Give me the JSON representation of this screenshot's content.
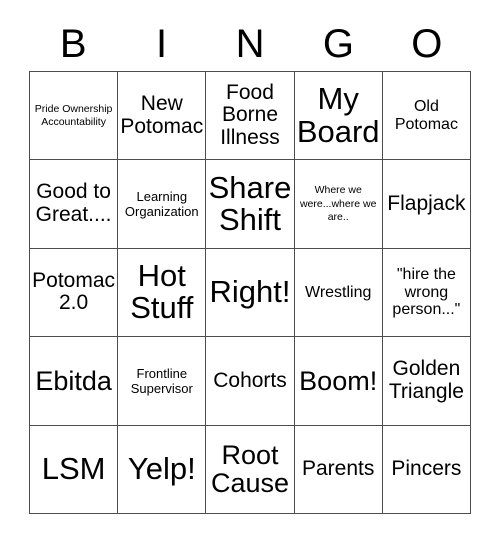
{
  "header": {
    "letters": [
      "B",
      "I",
      "N",
      "G",
      "O"
    ]
  },
  "grid": {
    "columns": 5,
    "rows": 5,
    "cells": [
      {
        "text": "Pride Ownership Accountability",
        "size": "xxs"
      },
      {
        "text": "New Potomac",
        "size": "md"
      },
      {
        "text": "Food Borne Illness",
        "size": "md"
      },
      {
        "text": "My Board",
        "size": "xl"
      },
      {
        "text": "Old Potomac",
        "size": "sm"
      },
      {
        "text": "Good to Great....",
        "size": "md"
      },
      {
        "text": "Learning Organization",
        "size": "xs"
      },
      {
        "text": "Share Shift",
        "size": "xl"
      },
      {
        "text": "Where we were...where we are..",
        "size": "xxs"
      },
      {
        "text": "Flapjack",
        "size": "md"
      },
      {
        "text": "Potomac 2.0",
        "size": "md"
      },
      {
        "text": "Hot Stuff",
        "size": "xl"
      },
      {
        "text": "Right!",
        "size": "xl"
      },
      {
        "text": "Wrestling",
        "size": "sm"
      },
      {
        "text": "\"hire the wrong person...\"",
        "size": "sm"
      },
      {
        "text": "Ebitda",
        "size": "lg"
      },
      {
        "text": "Frontline Supervisor",
        "size": "xs"
      },
      {
        "text": "Cohorts",
        "size": "md"
      },
      {
        "text": "Boom!",
        "size": "lg"
      },
      {
        "text": "Golden Triangle",
        "size": "md"
      },
      {
        "text": "LSM",
        "size": "xl"
      },
      {
        "text": "Yelp!",
        "size": "xl"
      },
      {
        "text": "Root Cause",
        "size": "lg"
      },
      {
        "text": "Parents",
        "size": "md"
      },
      {
        "text": "Pincers",
        "size": "md"
      }
    ]
  },
  "colors": {
    "background": "#ffffff",
    "text": "#000000",
    "border": "#4d4d4d"
  }
}
